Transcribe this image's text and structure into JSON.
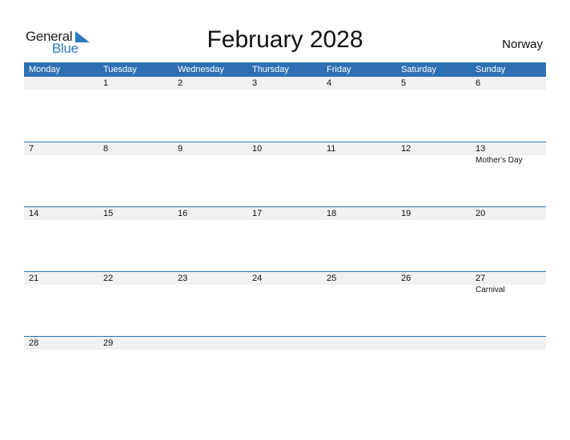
{
  "logo": {
    "word1": "General",
    "word2": "Blue"
  },
  "title": "February 2028",
  "country": "Norway",
  "weekdays": [
    "Monday",
    "Tuesday",
    "Wednesday",
    "Thursday",
    "Friday",
    "Saturday",
    "Sunday"
  ],
  "weeks": [
    {
      "days": [
        "",
        "1",
        "2",
        "3",
        "4",
        "5",
        "6"
      ],
      "events": [
        "",
        "",
        "",
        "",
        "",
        "",
        ""
      ]
    },
    {
      "days": [
        "7",
        "8",
        "9",
        "10",
        "11",
        "12",
        "13"
      ],
      "events": [
        "",
        "",
        "",
        "",
        "",
        "",
        "Mother's Day"
      ]
    },
    {
      "days": [
        "14",
        "15",
        "16",
        "17",
        "18",
        "19",
        "20"
      ],
      "events": [
        "",
        "",
        "",
        "",
        "",
        "",
        ""
      ]
    },
    {
      "days": [
        "21",
        "22",
        "23",
        "24",
        "25",
        "26",
        "27"
      ],
      "events": [
        "",
        "",
        "",
        "",
        "",
        "",
        "Carnival"
      ]
    },
    {
      "days": [
        "28",
        "29",
        "",
        "",
        "",
        "",
        ""
      ],
      "events": [
        "",
        "",
        "",
        "",
        "",
        "",
        ""
      ]
    }
  ],
  "colors": {
    "accent": "#2e70b3",
    "date_band": "#f1f1f1",
    "logo_blue": "#2a7abf"
  }
}
